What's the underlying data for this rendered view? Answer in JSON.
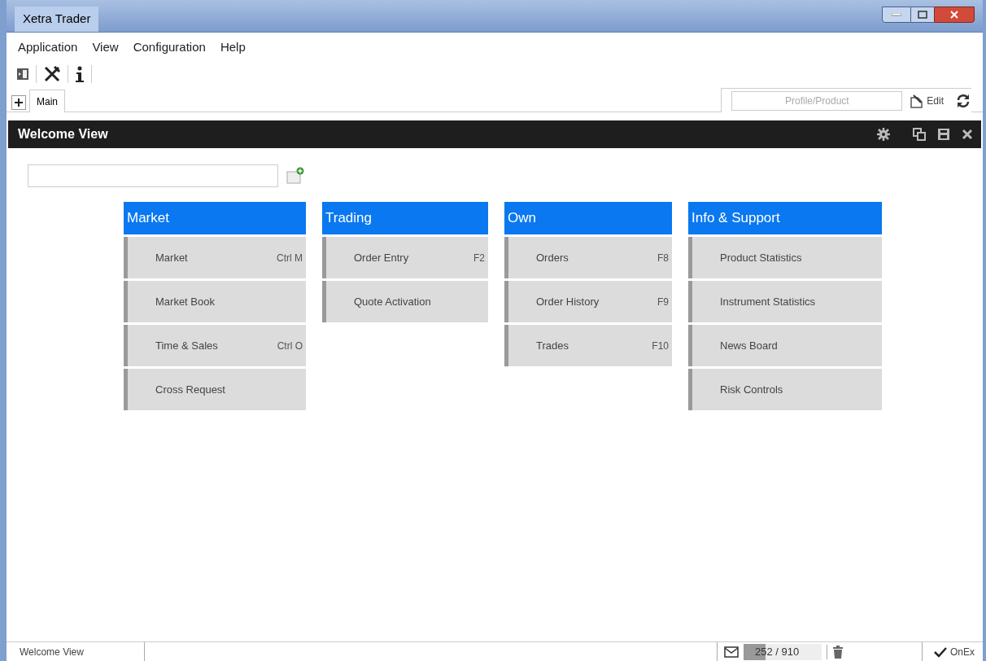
{
  "window": {
    "title": "Xetra Trader"
  },
  "menu": [
    "Application",
    "View",
    "Configuration",
    "Help"
  ],
  "tabs": [
    {
      "label": "Main",
      "selected": true
    }
  ],
  "profile_field": {
    "placeholder": "Profile/Product"
  },
  "edit_button": "Edit",
  "view": {
    "title": "Welcome View"
  },
  "groups": [
    {
      "title": "Market",
      "items": [
        {
          "label": "Market",
          "shortcut": "Ctrl M"
        },
        {
          "label": "Market Book"
        },
        {
          "label": "Time & Sales",
          "shortcut": "Ctrl O"
        },
        {
          "label": "Cross Request"
        }
      ]
    },
    {
      "title": "Trading",
      "items": [
        {
          "label": "Order Entry",
          "shortcut": "F2"
        },
        {
          "label": "Quote Activation"
        }
      ]
    },
    {
      "title": "Own",
      "items": [
        {
          "label": "Orders",
          "shortcut": "F8"
        },
        {
          "label": "Order History",
          "shortcut": "F9"
        },
        {
          "label": "Trades",
          "shortcut": "F10"
        }
      ]
    },
    {
      "title": "Info & Support",
      "items": [
        {
          "label": "Product Statistics"
        },
        {
          "label": "Instrument Statistics"
        },
        {
          "label": "News Board"
        },
        {
          "label": "Risk Controls"
        }
      ]
    }
  ],
  "status_bar": {
    "view": "Welcome View",
    "counter": "252 / 910",
    "level": 0.28,
    "connection": "OnEx"
  }
}
